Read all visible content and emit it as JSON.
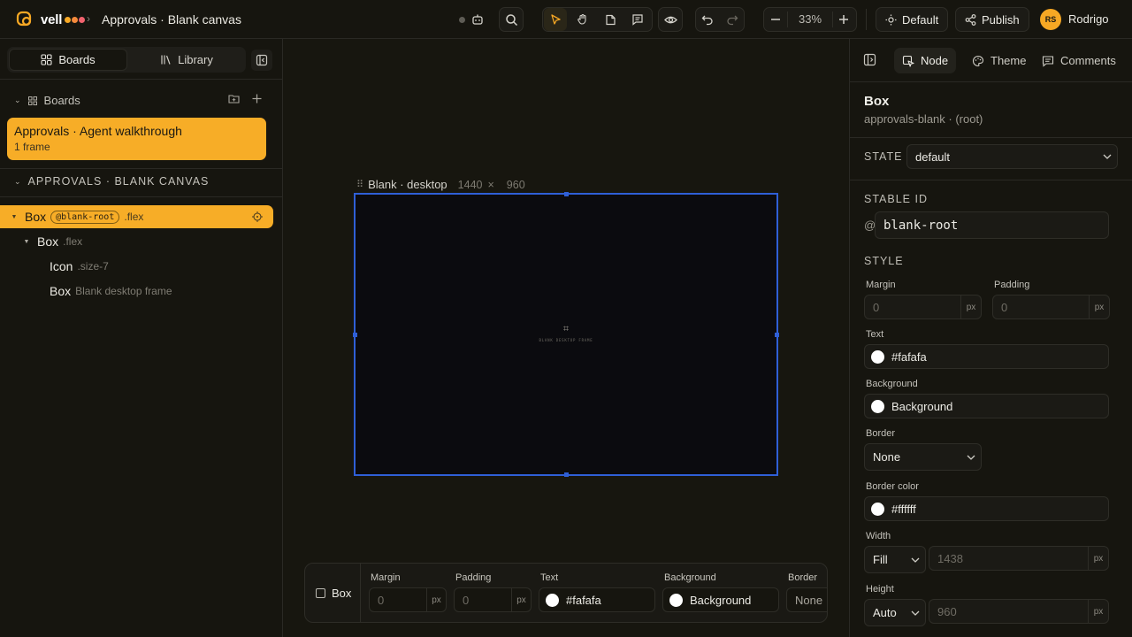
{
  "app": {
    "name": "vell",
    "breadcrumb": "Approvals · Blank canvas",
    "user_initials": "RS",
    "user_name": "Rodrigo"
  },
  "toolbar": {
    "zoom": "33%",
    "theme_label": "Default",
    "publish_label": "Publish"
  },
  "left_panel": {
    "tabs": [
      {
        "label": "Boards"
      },
      {
        "label": "Library"
      }
    ],
    "boards_heading": "Boards",
    "board_card": {
      "title": "Approvals · Agent walkthrough",
      "subtitle": "1 frame"
    },
    "tree_heading": "APPROVALS · BLANK CANVAS",
    "tree": [
      {
        "name": "Box",
        "tag": "@blank-root",
        "cls": ".flex"
      },
      {
        "name": "Box",
        "cls": ".flex"
      },
      {
        "name": "Icon",
        "cls": ".size-7"
      },
      {
        "name": "Box",
        "cls": "Blank desktop frame"
      }
    ]
  },
  "canvas": {
    "frame_name": "Blank · desktop",
    "frame_w": "1440",
    "frame_x": "×",
    "frame_h": "960",
    "frame_caption": "BLANK DESKTOP FRAME",
    "frame_icon": "⌗"
  },
  "bottom_bar": {
    "node_label": "Box",
    "margin_label": "Margin",
    "margin_value": "0",
    "padding_label": "Padding",
    "padding_value": "0",
    "text_label": "Text",
    "text_value": "#fafafa",
    "background_label": "Background",
    "background_value": "Background",
    "border_label": "Border",
    "border_value": "None",
    "unit": "px"
  },
  "right_panel": {
    "tabs": [
      {
        "label": "Node"
      },
      {
        "label": "Theme"
      },
      {
        "label": "Comments"
      }
    ],
    "title": "Box",
    "subtitle": "approvals-blank · (root)",
    "state_label": "STATE",
    "state_value": "default",
    "stable_id_label": "STABLE ID",
    "stable_id_prefix": "@",
    "stable_id_value": "blank-root",
    "style_label": "STYLE",
    "margin_label": "Margin",
    "margin_value": "0",
    "padding_label": "Padding",
    "padding_value": "0",
    "text_label": "Text",
    "text_value": "#fafafa",
    "background_label": "Background",
    "background_value": "Background",
    "border_label": "Border",
    "border_value": "None",
    "border_color_label": "Border color",
    "border_color_value": "#ffffff",
    "width_label": "Width",
    "width_mode": "Fill",
    "width_value": "1438",
    "height_label": "Height",
    "height_mode": "Auto",
    "height_value": "960",
    "unit": "px"
  },
  "colors": {
    "accent": "#f7ad27",
    "selection": "#2f5fd6",
    "background": "#16150f"
  }
}
